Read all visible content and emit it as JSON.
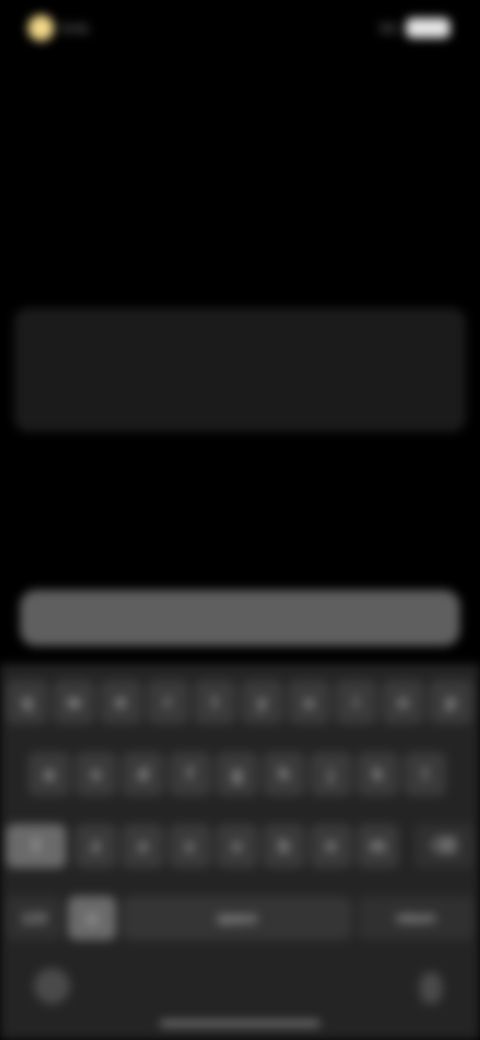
{
  "status_bar": {
    "time": "9:41",
    "right_text": "5G"
  },
  "header": {
    "step": "",
    "title": "",
    "subtitle": ""
  },
  "input": {
    "label": "",
    "value": "",
    "placeholder": ""
  },
  "continue_label": "",
  "keyboard": {
    "row1": [
      "q",
      "w",
      "e",
      "r",
      "t",
      "y",
      "u",
      "i",
      "o",
      "p"
    ],
    "row2": [
      "a",
      "s",
      "d",
      "f",
      "g",
      "h",
      "j",
      "k",
      "l"
    ],
    "row3": [
      "z",
      "x",
      "c",
      "v",
      "b",
      "n",
      "m"
    ],
    "numbers_label": "123",
    "space_label": "space",
    "return_label": "return"
  },
  "colors": {
    "accent": "#f4d98a",
    "background": "#000000",
    "card": "#1b1b1b",
    "button": "#5f5f5f",
    "keyboard": "#242424"
  },
  "icons": {
    "status_indicator": "yellow-dot-icon",
    "battery": "battery-icon",
    "shift": "shift-icon",
    "backspace": "backspace-icon",
    "globe": "globe-icon",
    "microphone": "microphone-icon"
  }
}
